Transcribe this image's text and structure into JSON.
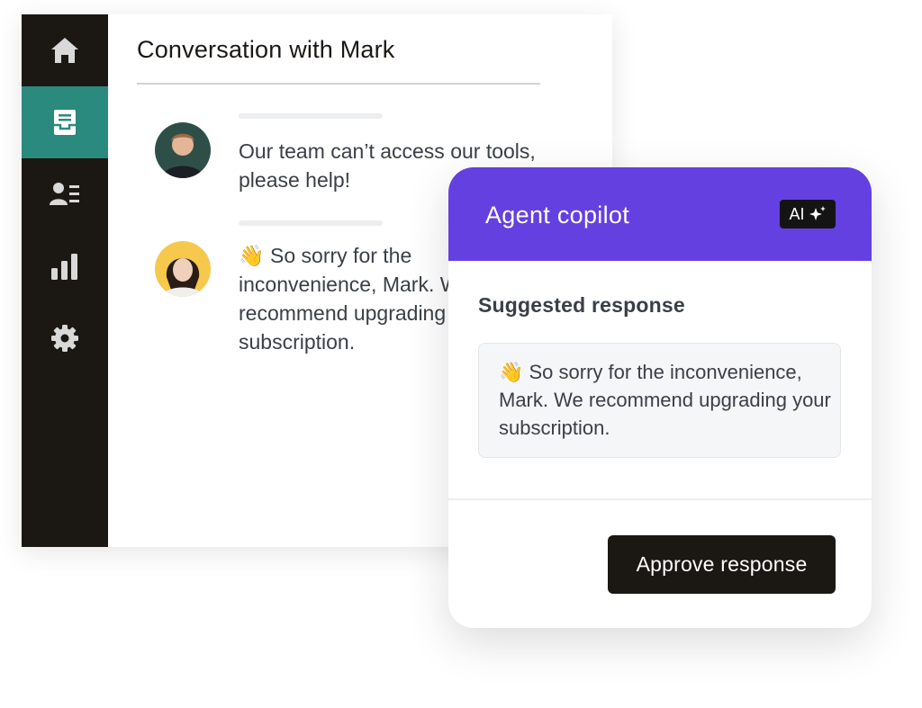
{
  "sidebar": {
    "items": [
      {
        "icon": "home-icon",
        "active": false
      },
      {
        "icon": "inbox-icon",
        "active": true
      },
      {
        "icon": "contacts-icon",
        "active": false
      },
      {
        "icon": "reports-icon",
        "active": false
      },
      {
        "icon": "settings-icon",
        "active": false
      }
    ]
  },
  "conversation": {
    "title": "Conversation with Mark",
    "messages": [
      {
        "sender": "Mark",
        "text": "Our team can’t access our tools, please help!"
      },
      {
        "sender": "agent",
        "text": "👋 So sorry for the inconvenience, Mark. We recommend upgrading your subscription."
      }
    ]
  },
  "copilot": {
    "title": "Agent copilot",
    "badge": "AI",
    "badge_icon": "sparkle-icon",
    "suggested_label": "Suggested response",
    "suggested_text": "👋 So sorry for the inconvenience, Mark. We recommend upgrading your subscription.",
    "approve_label": "Approve response"
  },
  "colors": {
    "sidebar_bg": "#1b1814",
    "active_nav": "#2b8a7e",
    "copilot_header": "#6440e0",
    "button_bg": "#1b1814"
  }
}
